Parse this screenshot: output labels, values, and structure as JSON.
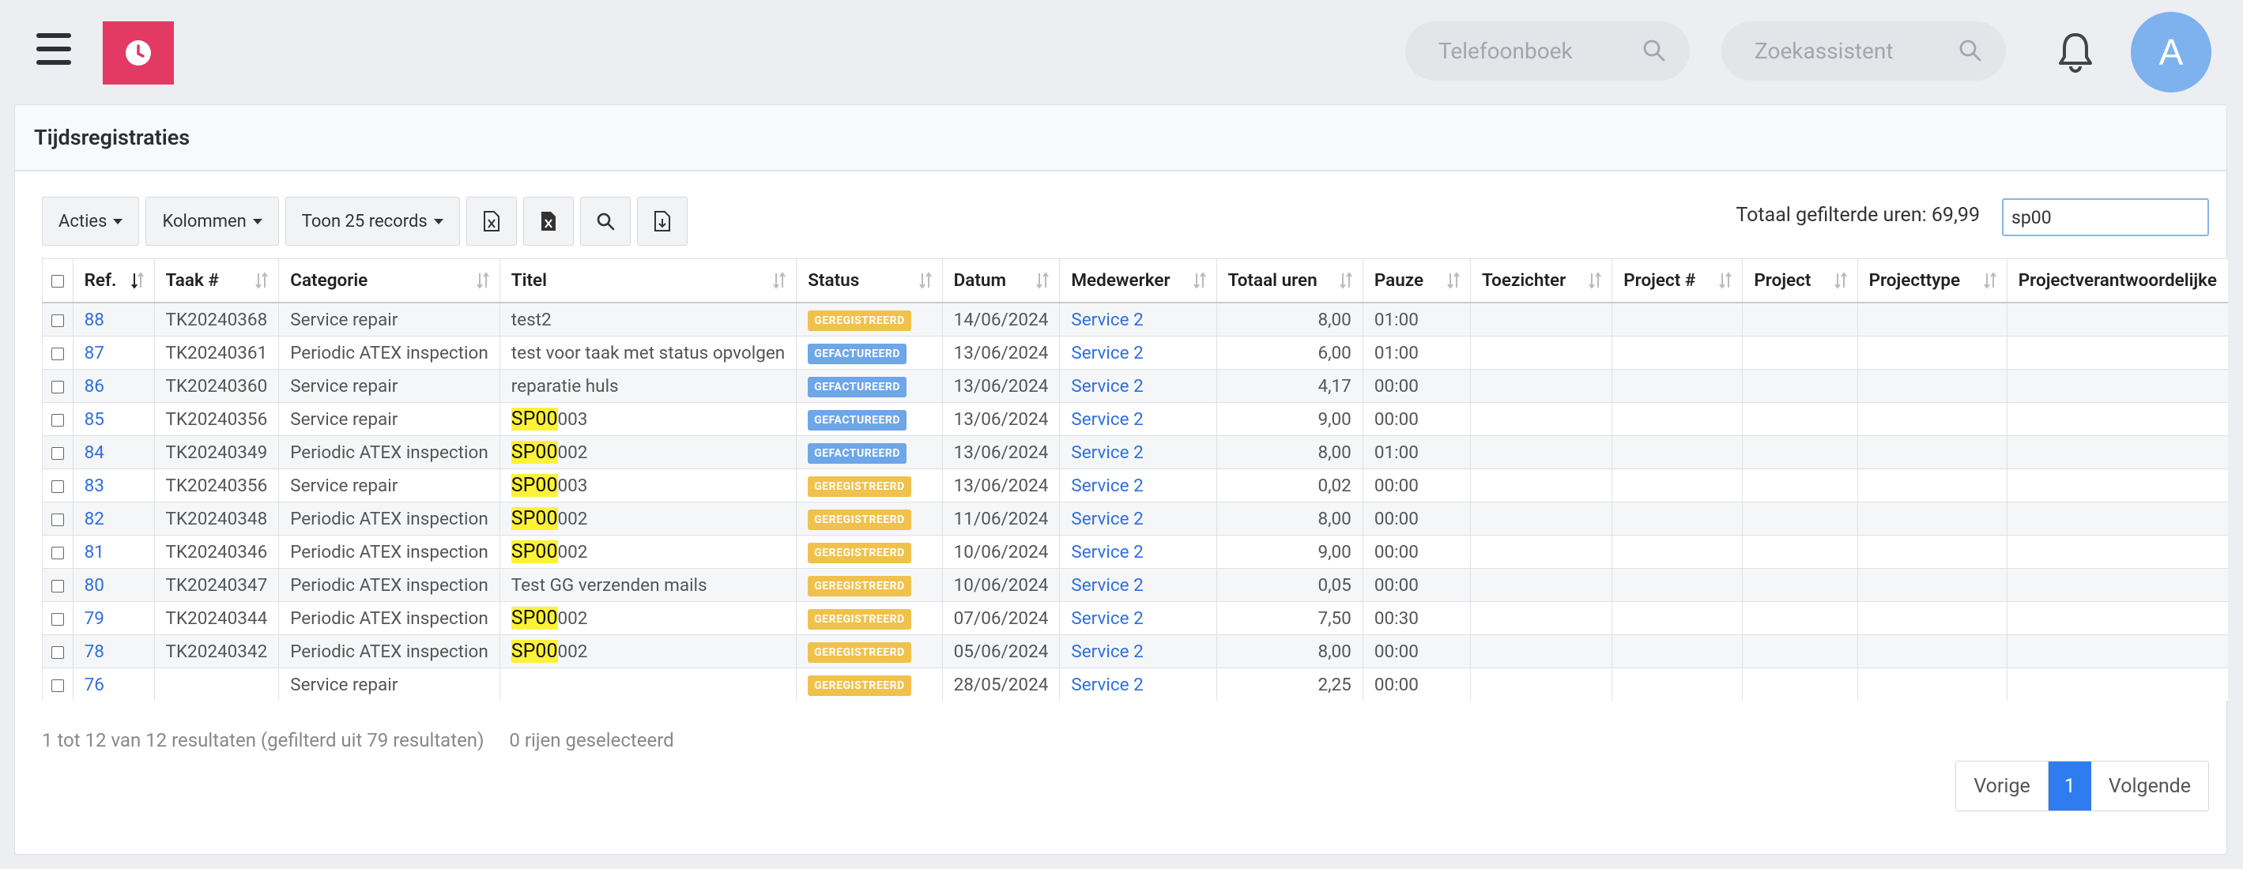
{
  "header": {
    "search1_placeholder": "Telefoonboek",
    "search2_placeholder": "Zoekassistent",
    "avatar_initial": "A"
  },
  "card": {
    "title": "Tijdsregistraties"
  },
  "toolbar": {
    "actions_label": "Acties",
    "columns_label": "Kolommen",
    "pagesize_label": "Toon 25 records",
    "icons": [
      "excel-export-icon",
      "excel-export-icon",
      "search-icon",
      "download-icon"
    ]
  },
  "total": {
    "label": "Totaal gefilterde uren: 69,99",
    "filter_value": "sp00"
  },
  "colors": {
    "brand": "#e23a63",
    "link": "#2f6fdc",
    "badge_geregistreerd": "#f0c14b",
    "badge_gefactureerd": "#6ea6e8",
    "highlight": "#fdf23a"
  },
  "table": {
    "columns": [
      "Ref.",
      "Taak #",
      "Categorie",
      "Titel",
      "Status",
      "Datum",
      "Medewerker",
      "Totaal uren",
      "Pauze",
      "Toezichter",
      "Project #",
      "Project",
      "Projecttype",
      "Projectverantwoordelijke"
    ],
    "rows": [
      {
        "ref": "88",
        "taak": "TK20240368",
        "cat": "Service repair",
        "title_hl": "",
        "title_rest": "test2",
        "status": "GEREGISTREERD",
        "datum": "14/06/2024",
        "emp": "Service 2",
        "uren": "8,00",
        "pauze": "01:00"
      },
      {
        "ref": "87",
        "taak": "TK20240361",
        "cat": "Periodic ATEX inspection",
        "title_hl": "",
        "title_rest": "test voor taak met status opvolgen",
        "status": "GEFACTUREERD",
        "datum": "13/06/2024",
        "emp": "Service 2",
        "uren": "6,00",
        "pauze": "01:00"
      },
      {
        "ref": "86",
        "taak": "TK20240360",
        "cat": "Service repair",
        "title_hl": "",
        "title_rest": "reparatie huls",
        "status": "GEFACTUREERD",
        "datum": "13/06/2024",
        "emp": "Service 2",
        "uren": "4,17",
        "pauze": "00:00"
      },
      {
        "ref": "85",
        "taak": "TK20240356",
        "cat": "Service repair",
        "title_hl": "SP00",
        "title_rest": "003",
        "status": "GEFACTUREERD",
        "datum": "13/06/2024",
        "emp": "Service 2",
        "uren": "9,00",
        "pauze": "00:00"
      },
      {
        "ref": "84",
        "taak": "TK20240349",
        "cat": "Periodic ATEX inspection",
        "title_hl": "SP00",
        "title_rest": "002",
        "status": "GEFACTUREERD",
        "datum": "13/06/2024",
        "emp": "Service 2",
        "uren": "8,00",
        "pauze": "01:00"
      },
      {
        "ref": "83",
        "taak": "TK20240356",
        "cat": "Service repair",
        "title_hl": "SP00",
        "title_rest": "003",
        "status": "GEREGISTREERD",
        "datum": "13/06/2024",
        "emp": "Service 2",
        "uren": "0,02",
        "pauze": "00:00"
      },
      {
        "ref": "82",
        "taak": "TK20240348",
        "cat": "Periodic ATEX inspection",
        "title_hl": "SP00",
        "title_rest": "002",
        "status": "GEREGISTREERD",
        "datum": "11/06/2024",
        "emp": "Service 2",
        "uren": "8,00",
        "pauze": "00:00"
      },
      {
        "ref": "81",
        "taak": "TK20240346",
        "cat": "Periodic ATEX inspection",
        "title_hl": "SP00",
        "title_rest": "002",
        "status": "GEREGISTREERD",
        "datum": "10/06/2024",
        "emp": "Service 2",
        "uren": "9,00",
        "pauze": "00:00"
      },
      {
        "ref": "80",
        "taak": "TK20240347",
        "cat": "Periodic ATEX inspection",
        "title_hl": "",
        "title_rest": "Test GG verzenden mails",
        "status": "GEREGISTREERD",
        "datum": "10/06/2024",
        "emp": "Service 2",
        "uren": "0,05",
        "pauze": "00:00"
      },
      {
        "ref": "79",
        "taak": "TK20240344",
        "cat": "Periodic ATEX inspection",
        "title_hl": "SP00",
        "title_rest": "002",
        "status": "GEREGISTREERD",
        "datum": "07/06/2024",
        "emp": "Service 2",
        "uren": "7,50",
        "pauze": "00:30"
      },
      {
        "ref": "78",
        "taak": "TK20240342",
        "cat": "Periodic ATEX inspection",
        "title_hl": "SP00",
        "title_rest": "002",
        "status": "GEREGISTREERD",
        "datum": "05/06/2024",
        "emp": "Service 2",
        "uren": "8,00",
        "pauze": "00:00"
      },
      {
        "ref": "76",
        "taak": "",
        "cat": "Service repair",
        "title_hl": "",
        "title_rest": "",
        "status": "GEREGISTREERD",
        "datum": "28/05/2024",
        "emp": "Service 2",
        "uren": "2,25",
        "pauze": "00:00"
      }
    ]
  },
  "footer": {
    "info": "1 tot 12 van 12 resultaten (gefilterd uit 79 resultaten)",
    "selected": "0 rijen geselecteerd",
    "prev": "Vorige",
    "page": "1",
    "next": "Volgende"
  }
}
